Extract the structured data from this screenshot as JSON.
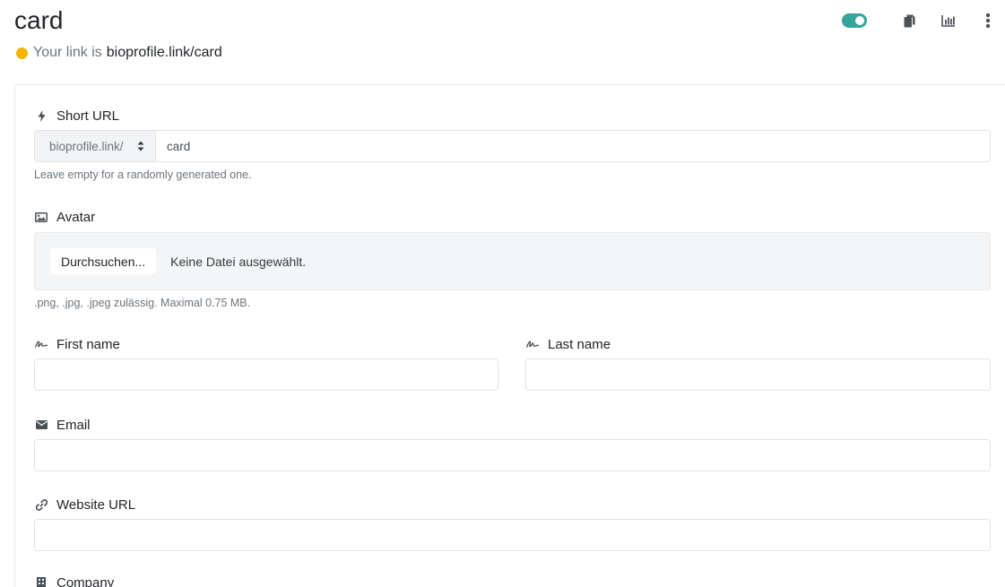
{
  "header": {
    "title": "card",
    "link_prefix": "Your link is",
    "link_url": "bioprofile.link/card",
    "status_color": "#f4b400",
    "toolbar": {
      "toggle_on": true,
      "toggle_color": "#34a59a",
      "icons": [
        "toggle-switch",
        "copy-icon",
        "statistics-icon",
        "more-vertical-icon"
      ]
    }
  },
  "form": {
    "short_url": {
      "label": "Short URL",
      "icon": "bolt-icon",
      "domain_option": "bioprofile.link/",
      "value": "card",
      "help": "Leave empty for a randomly generated one."
    },
    "avatar": {
      "label": "Avatar",
      "icon": "image-icon",
      "browse_label": "Durchsuchen...",
      "file_status": "Keine Datei ausgewählt.",
      "help": ".png, .jpg, .jpeg zulässig. Maximal 0.75 MB."
    },
    "first_name": {
      "label": "First name",
      "icon": "signature-icon",
      "value": ""
    },
    "last_name": {
      "label": "Last name",
      "icon": "signature-icon",
      "value": ""
    },
    "email": {
      "label": "Email",
      "icon": "envelope-icon",
      "value": ""
    },
    "website_url": {
      "label": "Website URL",
      "icon": "link-icon",
      "value": ""
    },
    "company": {
      "label": "Company",
      "icon": "building-icon"
    }
  }
}
